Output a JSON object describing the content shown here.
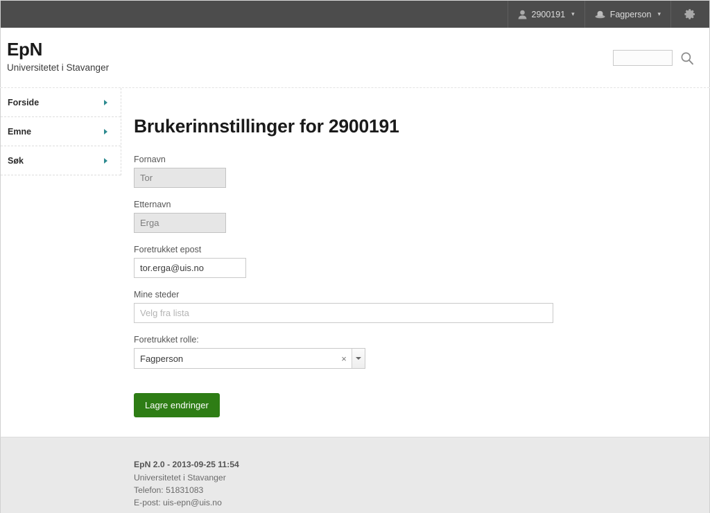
{
  "topbar": {
    "user": {
      "icon": "user-icon",
      "label": "2900191",
      "caret": "▾"
    },
    "role": {
      "icon": "hat-icon",
      "label": "Fagperson",
      "caret": "▾"
    },
    "settings": {
      "icon": "gear-icon"
    }
  },
  "header": {
    "brand_title": "EpN",
    "brand_subtitle": "Universitetet i Stavanger",
    "search": {
      "value": "",
      "placeholder": "",
      "icon": "search-icon"
    }
  },
  "sidebar": {
    "items": [
      {
        "label": "Forside",
        "icon": "chevron-right-icon"
      },
      {
        "label": "Emne",
        "icon": "chevron-right-icon"
      },
      {
        "label": "Søk",
        "icon": "chevron-right-icon"
      }
    ]
  },
  "main": {
    "page_title": "Brukerinnstillinger for 2900191",
    "fields": [
      {
        "label": "Fornavn",
        "value": "Tor",
        "placeholder": "",
        "disabled": true
      },
      {
        "label": "Etternavn",
        "value": "Erga",
        "placeholder": "",
        "disabled": true
      },
      {
        "label": "Foretrukket epost",
        "value": "tor.erga@uis.no",
        "placeholder": "",
        "disabled": false
      },
      {
        "label": "Mine steder",
        "value": "",
        "placeholder": "Velg fra lista",
        "disabled": false
      }
    ],
    "role_field": {
      "label": "Foretrukket rolle:",
      "value": "Fagperson",
      "clear_glyph": "×",
      "toggle_icon": "chevron-down-icon"
    },
    "save_label": "Lagre endringer"
  },
  "footer": {
    "version_line": "EpN 2.0 - 2013-09-25 11:54",
    "organisation": "Universitetet i Stavanger",
    "phone": "Telefon: 51831083",
    "email": "E-post: uis-epn@uis.no"
  },
  "colors": {
    "topbar_bg": "#4c4c4c",
    "accent_green": "#2e7d15",
    "nav_arrow": "#2e8b90",
    "footer_bg": "#e9e9e9"
  }
}
